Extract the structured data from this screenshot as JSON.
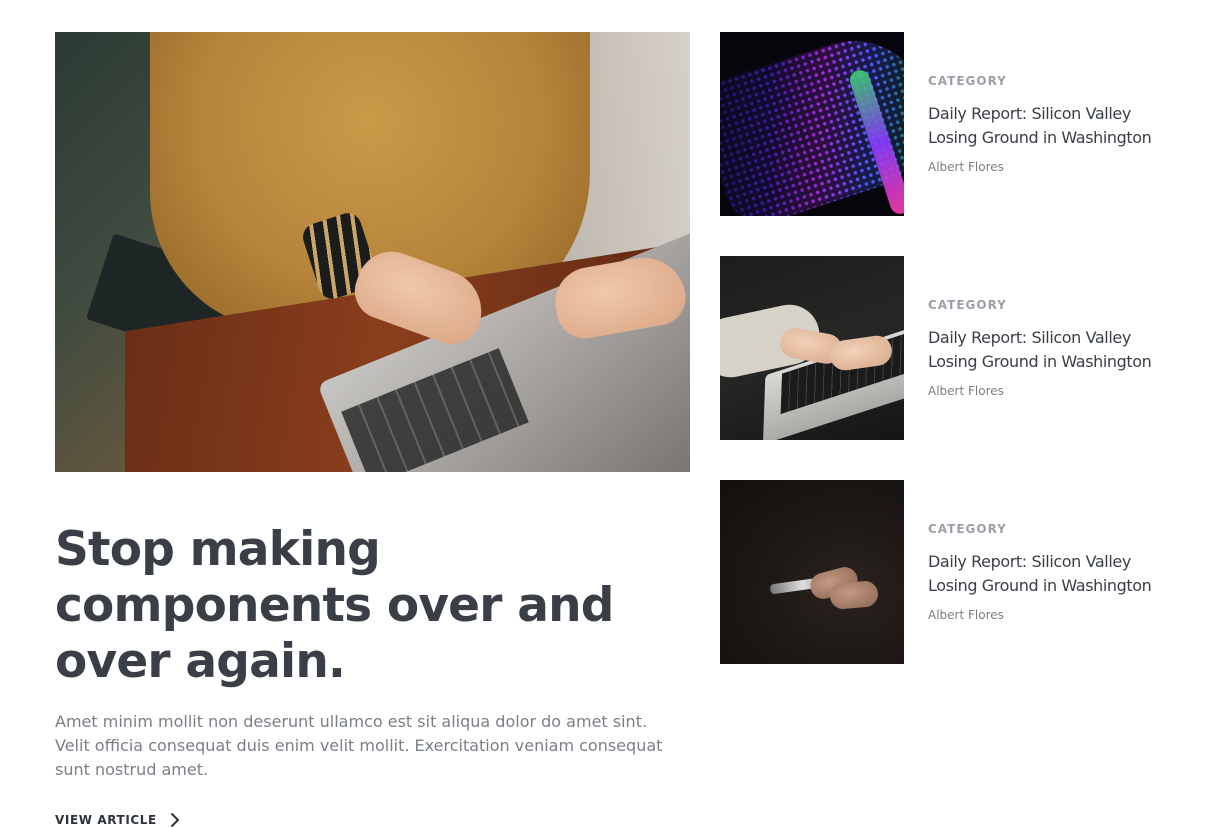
{
  "featured": {
    "headline": "Stop making components over and over again.",
    "summary": "Amet minim mollit non deserunt ullamco est sit aliqua dolor do amet sint. Velit officia consequat duis enim velit mollit. Exercitation veniam consequat sunt nostrud amet.",
    "cta_label": "VIEW ARTICLE",
    "cta_icon": "chevron-right-icon",
    "image": "woman-typing-on-laptop-photo"
  },
  "side_articles": [
    {
      "category": "CATEGORY",
      "title": "Daily Report: Silicon Valley Losing Ground in Washington",
      "author": "Albert Flores",
      "image": "neon-speaker-photo"
    },
    {
      "category": "CATEGORY",
      "title": "Daily Report: Silicon Valley Losing Ground in Washington",
      "author": "Albert Flores",
      "image": "hands-on-laptop-keyboard-photo"
    },
    {
      "category": "CATEGORY",
      "title": "Daily Report: Silicon Valley Losing Ground in Washington",
      "author": "Albert Flores",
      "image": "hands-holding-phone-photo"
    }
  ],
  "colors": {
    "heading": "#3a3f47",
    "body": "#7a7f87",
    "category": "#9aa0a8",
    "background": "#ffffff"
  }
}
